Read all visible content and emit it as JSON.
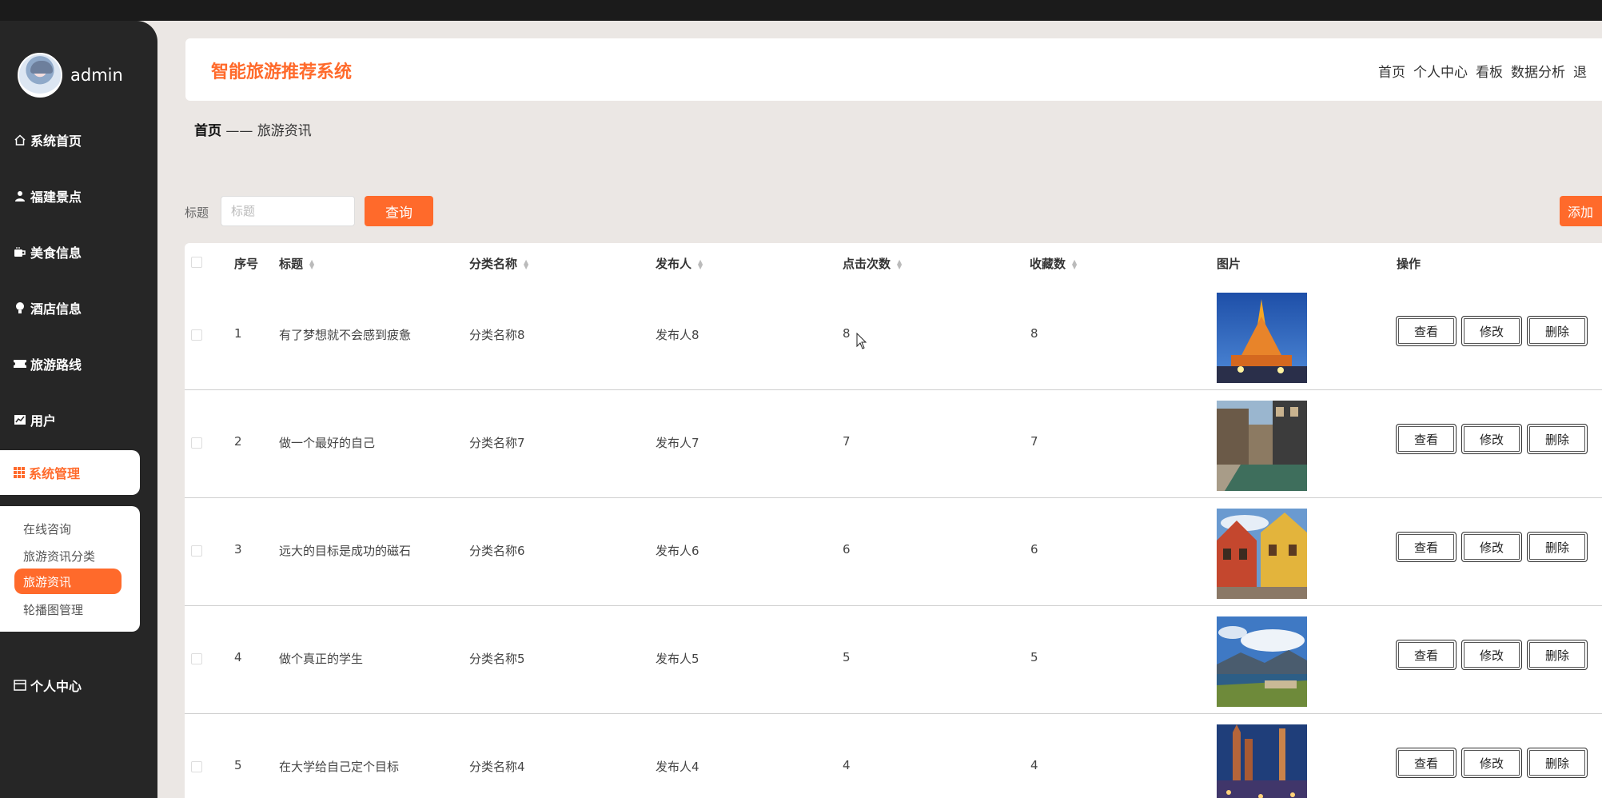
{
  "user": {
    "name": "admin"
  },
  "sidebar": {
    "items": [
      {
        "label": "系统首页",
        "icon": "home-icon"
      },
      {
        "label": "福建景点",
        "icon": "user-icon"
      },
      {
        "label": "美食信息",
        "icon": "tea-icon"
      },
      {
        "label": "酒店信息",
        "icon": "bulb-icon"
      },
      {
        "label": "旅游路线",
        "icon": "ticket-icon"
      },
      {
        "label": "用户",
        "icon": "chart-icon"
      }
    ],
    "active_group": {
      "label": "系统管理",
      "icon": "grid-icon"
    },
    "submenu": [
      "在线咨询",
      "旅游资讯分类",
      "旅游资讯",
      "轮播图管理"
    ],
    "submenu_active_index": 2,
    "personal": {
      "label": "个人中心",
      "icon": "card-icon"
    }
  },
  "header": {
    "title": "智能旅游推荐系统",
    "nav": [
      "首页",
      "个人中心",
      "看板",
      "数据分析",
      "退"
    ]
  },
  "breadcrumb": {
    "home": "首页",
    "separator": "——",
    "current": "旅游资讯"
  },
  "search": {
    "label": "标题",
    "placeholder": "标题",
    "value": "",
    "button": "查询"
  },
  "add_button": "添加",
  "table": {
    "columns": [
      "序号",
      "标题",
      "分类名称",
      "发布人",
      "点击次数",
      "收藏数",
      "图片",
      "操作"
    ],
    "rows": [
      {
        "no": "1",
        "title": "有了梦想就不会感到疲惫",
        "category": "分类名称8",
        "publisher": "发布人8",
        "clicks": "8",
        "favorites": "8",
        "image": "temple-night"
      },
      {
        "no": "2",
        "title": "做一个最好的自己",
        "category": "分类名称7",
        "publisher": "发布人7",
        "clicks": "7",
        "favorites": "7",
        "image": "canal-town"
      },
      {
        "no": "3",
        "title": "远大的目标是成功的磁石",
        "category": "分类名称6",
        "publisher": "发布人6",
        "clicks": "6",
        "favorites": "6",
        "image": "timber-houses"
      },
      {
        "no": "4",
        "title": "做个真正的学生",
        "category": "分类名称5",
        "publisher": "发布人5",
        "clicks": "5",
        "favorites": "5",
        "image": "lake-valley"
      },
      {
        "no": "5",
        "title": "在大学给自己定个目标",
        "category": "分类名称4",
        "publisher": "发布人4",
        "clicks": "4",
        "favorites": "4",
        "image": "city-night"
      }
    ],
    "actions": [
      "查看",
      "修改",
      "删除"
    ]
  },
  "colors": {
    "accent": "#ff6a2b",
    "sidebar": "#262626",
    "background": "#ebe7e4"
  }
}
